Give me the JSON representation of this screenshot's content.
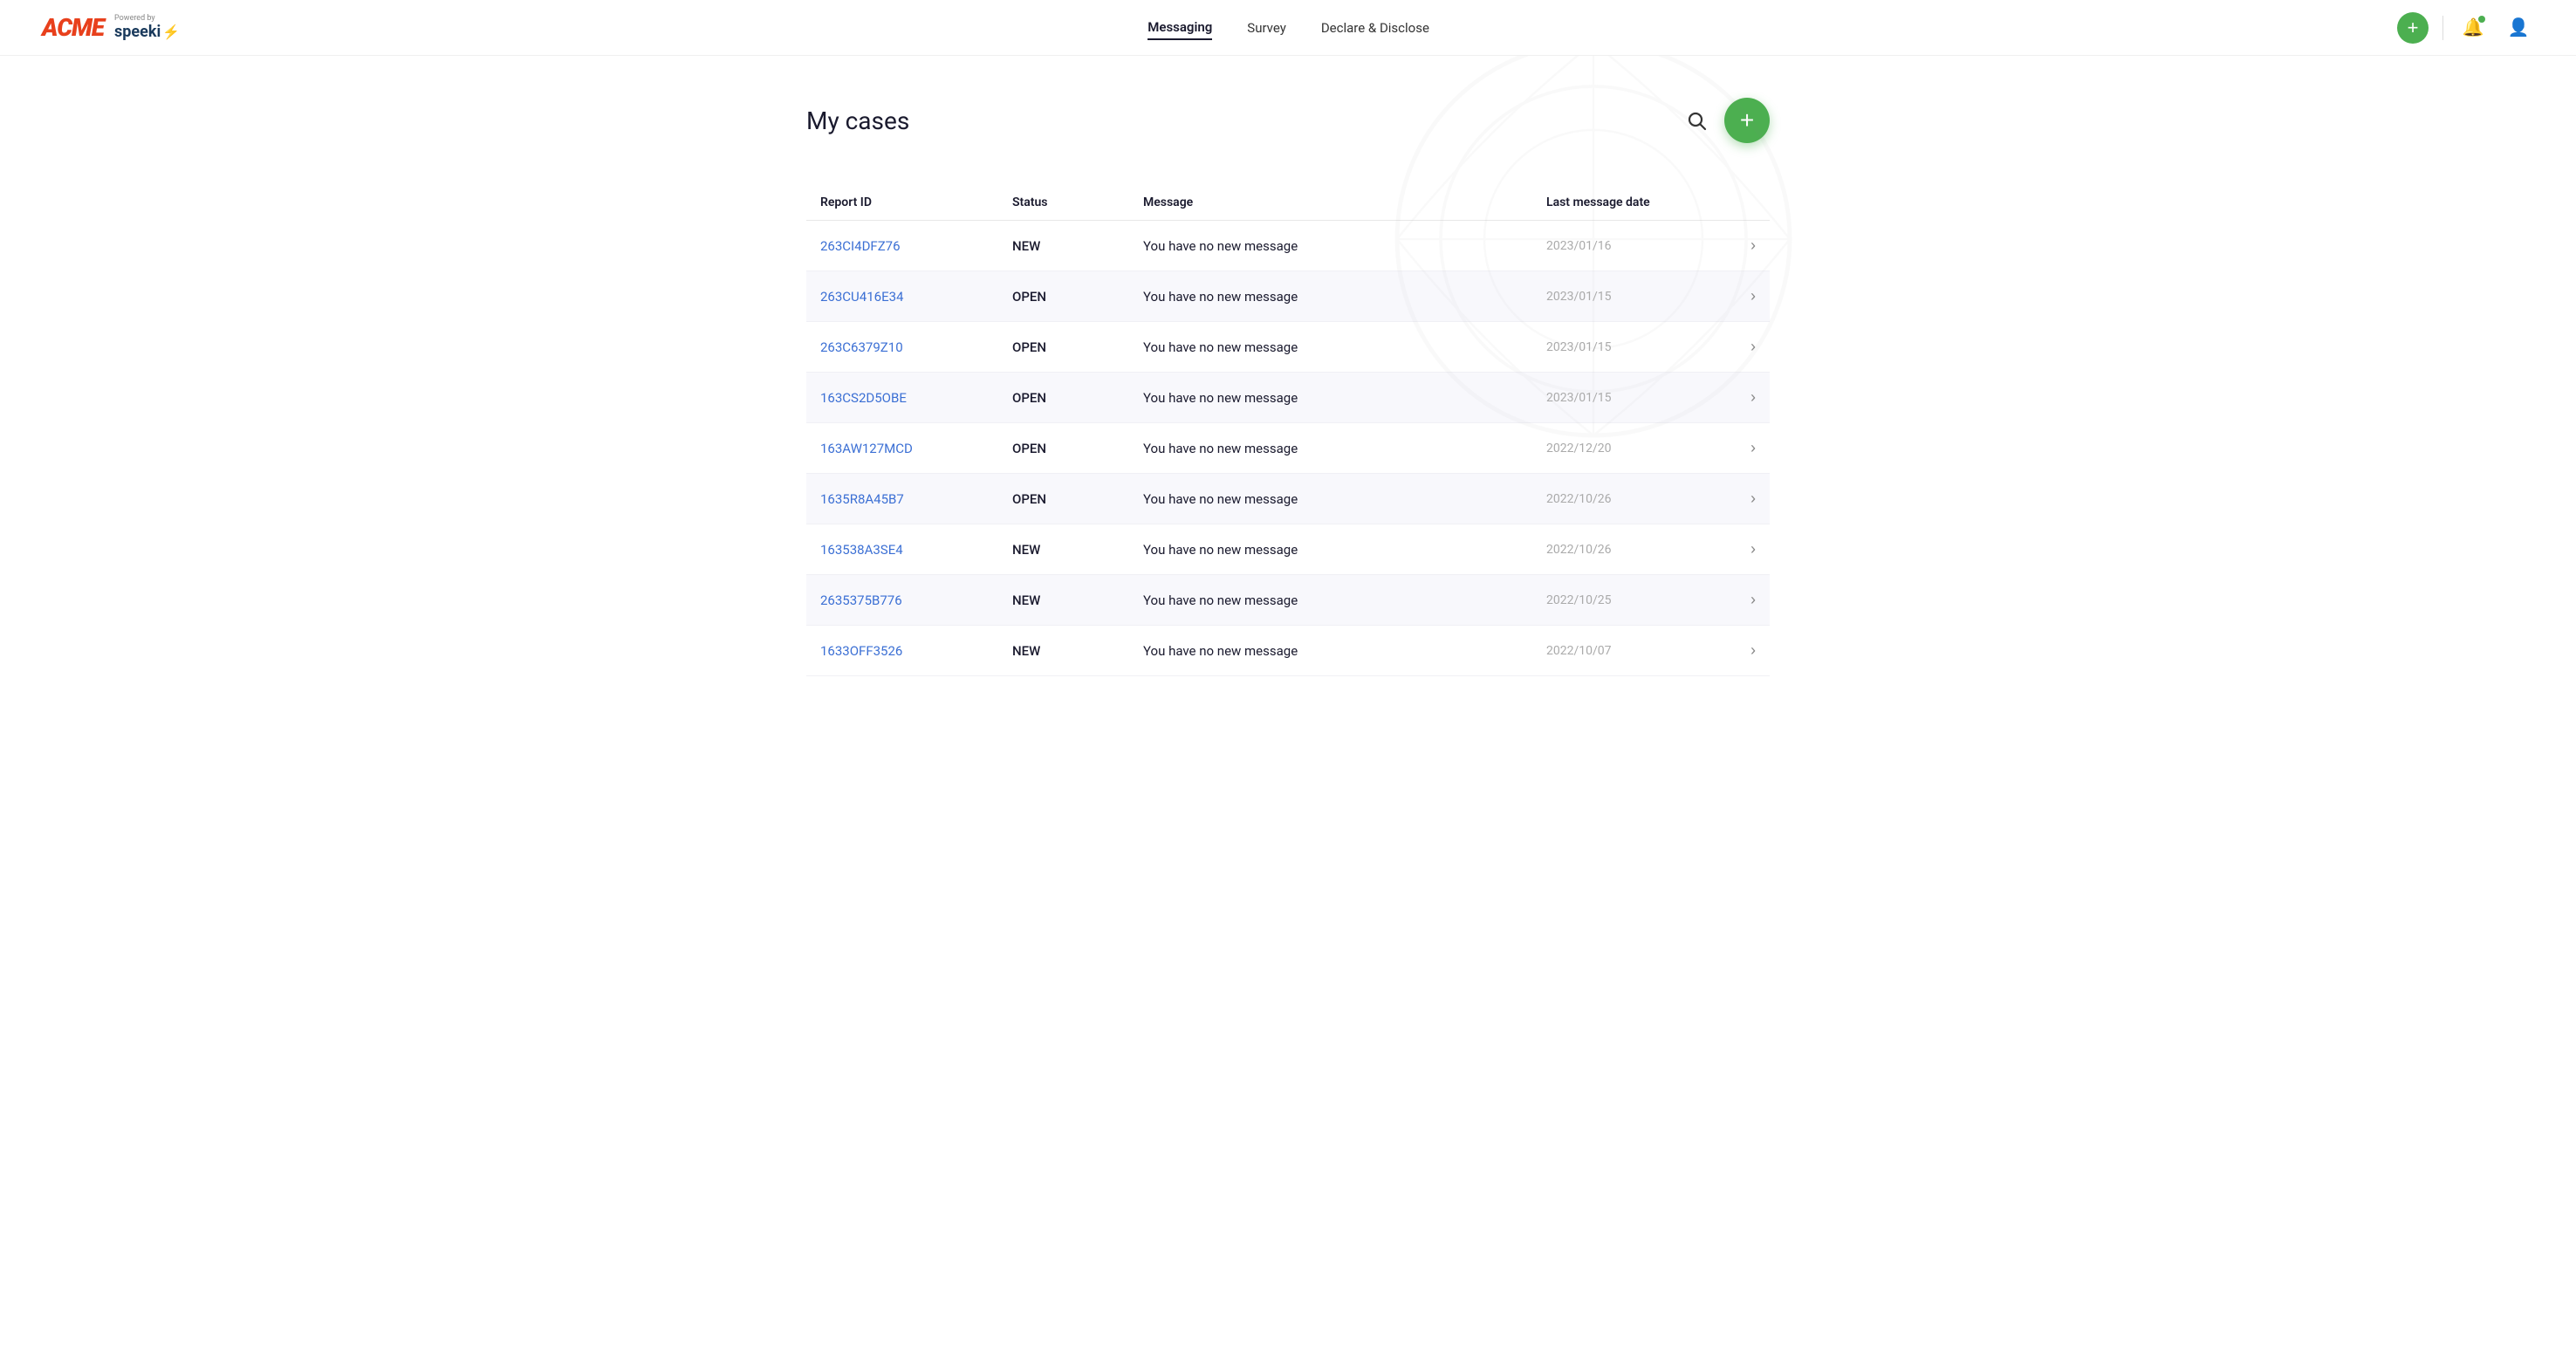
{
  "header": {
    "logo_acme": "ACME",
    "powered_by": "Powered by",
    "speeki": "speeki",
    "nav": {
      "messaging": "Messaging",
      "survey": "Survey",
      "declare_disclose": "Declare & Disclose"
    },
    "add_label": "+",
    "active_nav": "messaging"
  },
  "page": {
    "title": "My cases",
    "search_icon": "🔍",
    "add_icon": "+"
  },
  "table": {
    "columns": [
      "Report ID",
      "Status",
      "Message",
      "Last message date",
      ""
    ],
    "rows": [
      {
        "id": "263CI4DFZ76",
        "status": "NEW",
        "message": "You have no new message",
        "date": "2023/01/16"
      },
      {
        "id": "263CU416E34",
        "status": "OPEN",
        "message": "You have no new message",
        "date": "2023/01/15"
      },
      {
        "id": "263C6379Z10",
        "status": "OPEN",
        "message": "You have no new message",
        "date": "2023/01/15"
      },
      {
        "id": "163CS2D5OBE",
        "status": "OPEN",
        "message": "You have no new message",
        "date": "2023/01/15"
      },
      {
        "id": "163AW127MCD",
        "status": "OPEN",
        "message": "You have no new message",
        "date": "2022/12/20"
      },
      {
        "id": "1635R8A45B7",
        "status": "OPEN",
        "message": "You have no new message",
        "date": "2022/10/26"
      },
      {
        "id": "163538A3SE4",
        "status": "NEW",
        "message": "You have no new message",
        "date": "2022/10/26"
      },
      {
        "id": "2635375B776",
        "status": "NEW",
        "message": "You have no new message",
        "date": "2022/10/25"
      },
      {
        "id": "1633OFF3526",
        "status": "NEW",
        "message": "You have no new message",
        "date": "2022/10/07"
      }
    ]
  },
  "colors": {
    "accent_green": "#4caf50",
    "link_blue": "#3b6fd4",
    "text_dark": "#1a1a2e",
    "text_muted": "#aaaaaa",
    "logo_red": "#e8401c"
  }
}
